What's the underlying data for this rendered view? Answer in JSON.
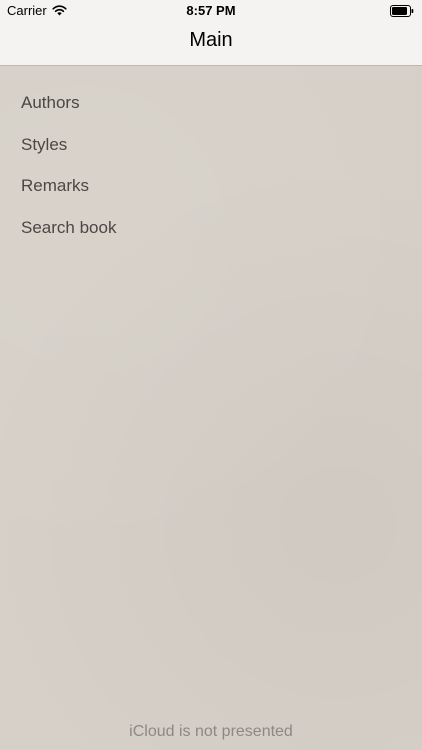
{
  "status_bar": {
    "carrier": "Carrier",
    "time": "8:57 PM",
    "wifi_icon": "wifi-icon",
    "battery_icon": "battery-icon"
  },
  "nav": {
    "title": "Main"
  },
  "menu": {
    "items": [
      {
        "label": "Authors"
      },
      {
        "label": "Styles"
      },
      {
        "label": "Remarks"
      },
      {
        "label": "Search book"
      }
    ]
  },
  "footer": {
    "status_text": "iCloud is not presented"
  },
  "colors": {
    "background": "#d6d0c8",
    "navbar": "#f5f3f1",
    "menu_text": "#4a4744",
    "footer_text": "#8d8884"
  }
}
